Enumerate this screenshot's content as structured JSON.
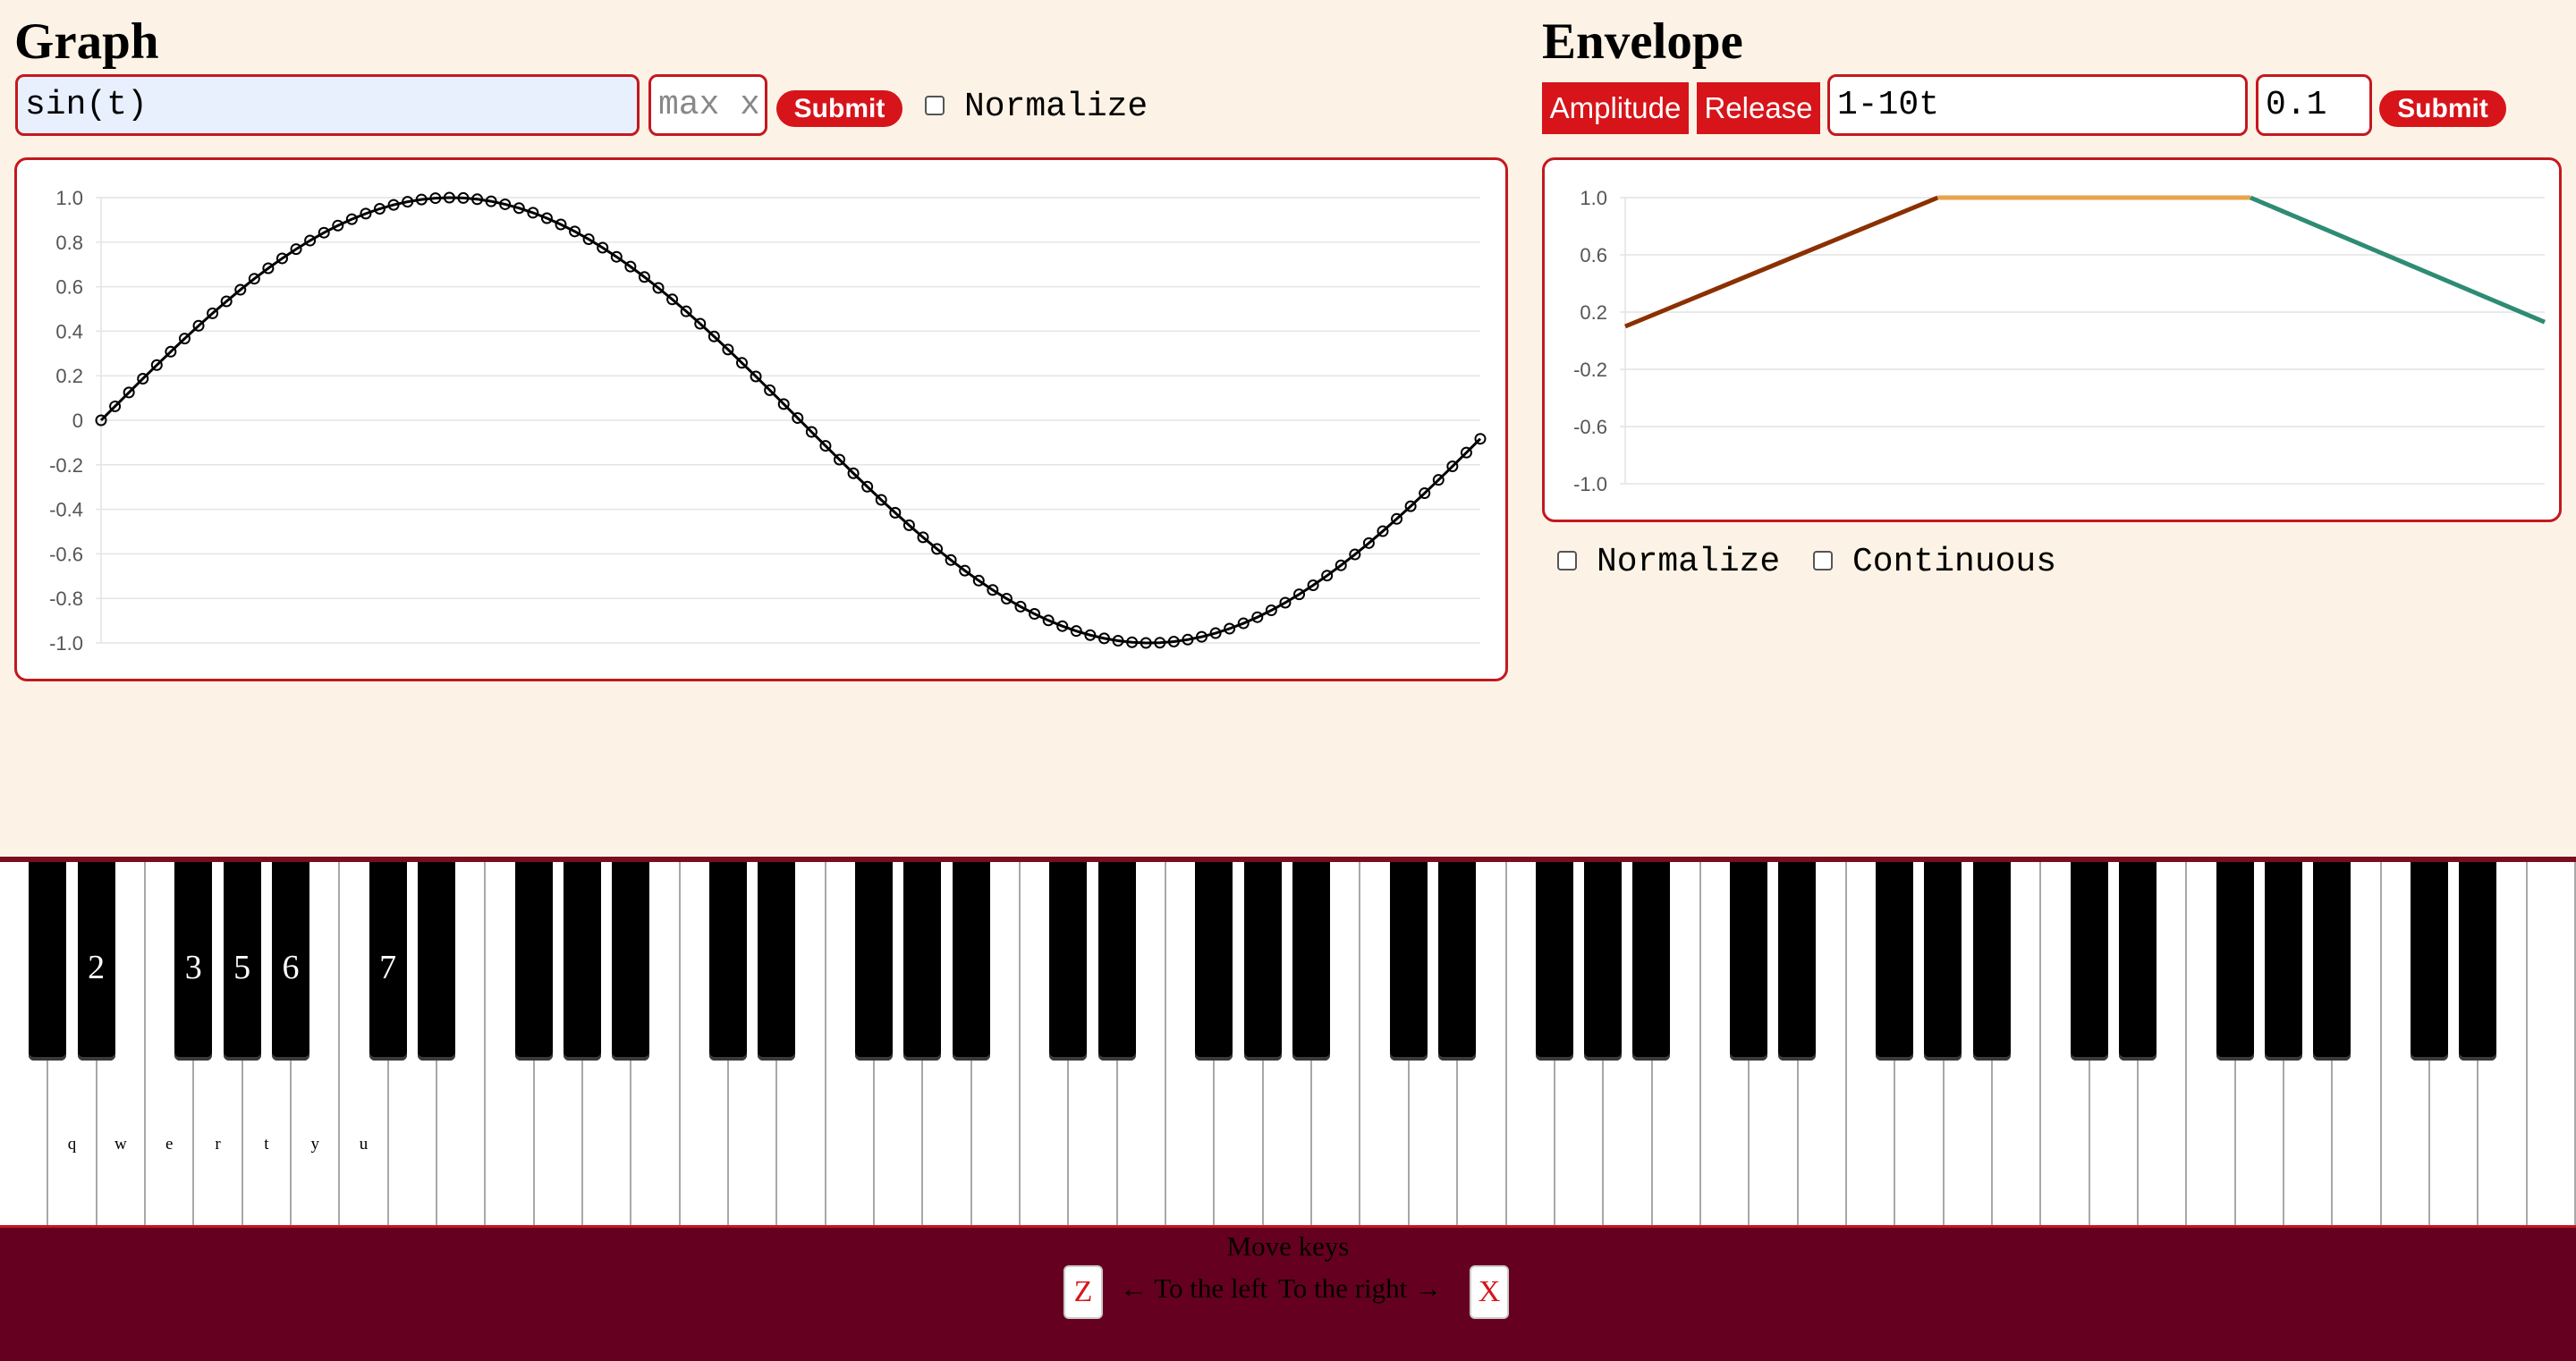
{
  "graph": {
    "title": "Graph",
    "expression_value": "sin(t)",
    "max_x_placeholder": "max x",
    "submit_label": "Submit",
    "normalize_label": "Normalize",
    "normalize_checked": false
  },
  "envelope": {
    "title": "Envelope",
    "amplitude_label": "Amplitude",
    "release_label": "Release",
    "expression_value": "1-10t",
    "duration_value": "0.1",
    "submit_label": "Submit",
    "normalize_label": "Normalize",
    "normalize_checked": false,
    "continuous_label": "Continuous",
    "continuous_checked": false
  },
  "piano": {
    "white_key_count": 53,
    "white_key_labels": [
      "",
      "q",
      "w",
      "e",
      "r",
      "t",
      "y",
      "u"
    ],
    "black_key_labels": [
      "",
      "2",
      "3",
      "5",
      "6",
      "7"
    ]
  },
  "move_keys": {
    "title": "Move keys",
    "left_key": "Z",
    "left_text": "← To the left",
    "right_text": "To the right →",
    "right_key": "X"
  },
  "chart_data": [
    {
      "type": "line",
      "name": "graph",
      "expression": "sin(t)",
      "x_range": [
        0,
        6.2
      ],
      "samples": 100,
      "ylim": [
        -1.0,
        1.0
      ],
      "y_ticks": [
        "1.0",
        "0.8",
        "0.6",
        "0.4",
        "0.2",
        "0",
        "-0.2",
        "-0.4",
        "-0.6",
        "-0.8",
        "-1.0"
      ],
      "grid": true,
      "markers": "circle",
      "line_color": "#000000"
    },
    {
      "type": "line",
      "name": "envelope",
      "ylim": [
        -1.0,
        1.0
      ],
      "y_ticks": [
        "1.0",
        "0.6",
        "0.2",
        "-0.2",
        "-0.6",
        "-1.0"
      ],
      "grid": true,
      "series": [
        {
          "color": "#8b3000",
          "x": [
            0,
            0.34
          ],
          "y": [
            0.1,
            1.0
          ]
        },
        {
          "color": "#e8a34c",
          "x": [
            0.34,
            0.68
          ],
          "y": [
            1.0,
            1.0
          ]
        },
        {
          "color": "#2e8b74",
          "x": [
            0.68,
            1.0
          ],
          "y": [
            1.0,
            0.13
          ]
        }
      ]
    }
  ]
}
